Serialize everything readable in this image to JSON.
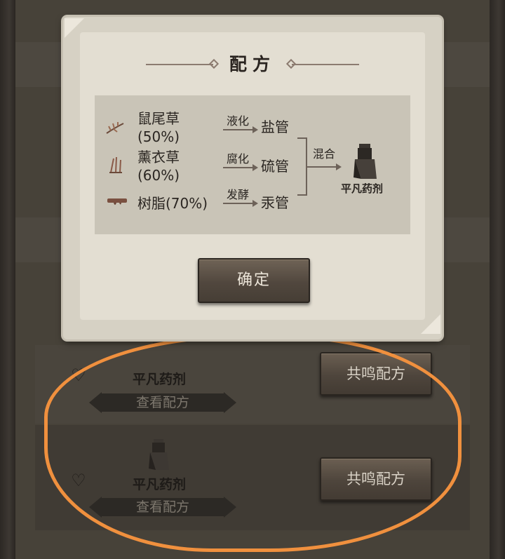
{
  "dialog": {
    "title": "配方",
    "ingredients": [
      {
        "name": "鼠尾草",
        "pct": "(50%)",
        "icon": "sage-icon"
      },
      {
        "name": "薰衣草",
        "pct": "(60%)",
        "icon": "lavender-icon"
      },
      {
        "name": "树脂(70%)",
        "icon": "resin-icon"
      }
    ],
    "processes": [
      "液化",
      "腐化",
      "发酵"
    ],
    "pipes": [
      "盐管",
      "硫管",
      "汞管"
    ],
    "combine": "混合",
    "result": "平凡药剂",
    "confirm": "确定"
  },
  "list": {
    "items": [
      {
        "name": "平凡药剂",
        "view": "查看配方",
        "action": "共鸣配方"
      },
      {
        "name": "平凡药剂",
        "view": "查看配方",
        "action": "共鸣配方"
      }
    ]
  },
  "colors": {
    "highlight": "#f0903e",
    "paper": "#e3ded2",
    "wood": "#51473e"
  }
}
